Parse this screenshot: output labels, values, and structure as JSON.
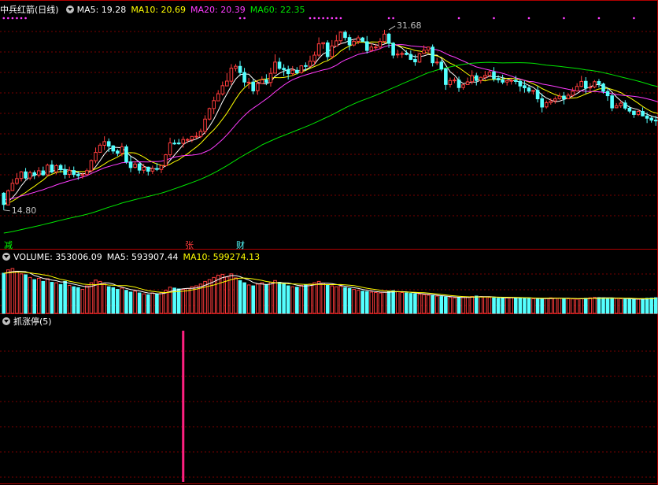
{
  "main_legend": {
    "stock_title": "中兵红箭(日线)",
    "ma5": "MA5: 19.28",
    "ma10": "MA10: 20.69",
    "ma20": "MA20: 20.39",
    "ma60": "MA60: 22.35"
  },
  "volume_legend": {
    "volume": "VOLUME: 353006.09",
    "ma5": "MA5: 593907.44",
    "ma10": "MA10: 599274.13"
  },
  "indicator_legend": {
    "name": "抓涨停(5)"
  },
  "event_tags": {
    "jian": "减",
    "zhang": "张",
    "cai": "财"
  },
  "colors": {
    "up": "#ff3c3c",
    "down": "#54ffff",
    "ma5": "#ffffff",
    "ma10": "#ffff00",
    "ma20": "#ff3cff",
    "ma60": "#00e600",
    "grid": "#7a0000",
    "bar_signal": "#ff2080",
    "magenta_dots": "#ff3cff"
  },
  "chart_data": [
    {
      "type": "candlestick",
      "title": "中兵红箭(日线)",
      "ylim": [
        12.5,
        33
      ],
      "annotations": [
        {
          "text": "31.68",
          "x": 88,
          "y": 31.68,
          "kind": "high"
        },
        {
          "text": "14.80",
          "x": 0,
          "y": 14.8,
          "kind": "low"
        }
      ],
      "ma_last": {
        "MA5": 19.28,
        "MA10": 20.69,
        "MA20": 20.39,
        "MA60": 22.35
      },
      "candles": [
        [
          16.38,
          15.32,
          16.48,
          14.8
        ],
        [
          15.28,
          16.61,
          16.73,
          15.28
        ],
        [
          16.63,
          17.31,
          17.72,
          16.59
        ],
        [
          17.3,
          17.75,
          18.27,
          17.16
        ],
        [
          17.76,
          18.38,
          18.46,
          17.48
        ],
        [
          18.38,
          17.8,
          18.74,
          17.66
        ],
        [
          17.8,
          18.31,
          18.49,
          17.59
        ],
        [
          18.3,
          18.05,
          18.51,
          17.7
        ],
        [
          18.08,
          18.48,
          18.82,
          17.86
        ],
        [
          18.47,
          18.1,
          18.87,
          17.99
        ],
        [
          18.1,
          19.01,
          19.15,
          17.92
        ],
        [
          19.03,
          18.37,
          19.47,
          18.23
        ],
        [
          18.38,
          18.96,
          19.1,
          18.15
        ],
        [
          18.97,
          18.58,
          19.14,
          18.3
        ],
        [
          18.59,
          18.14,
          19.07,
          17.75
        ],
        [
          18.14,
          18.52,
          18.87,
          17.81
        ],
        [
          18.5,
          18.13,
          18.88,
          17.86
        ],
        [
          18.14,
          18.02,
          18.42,
          17.64
        ],
        [
          18.04,
          18.13,
          18.29,
          17.74
        ],
        [
          18.13,
          18.49,
          18.7,
          18.1
        ],
        [
          18.48,
          19.44,
          19.55,
          18.31
        ],
        [
          19.42,
          20.2,
          20.66,
          19.18
        ],
        [
          20.21,
          20.88,
          21.07,
          20.17
        ],
        [
          20.87,
          21.21,
          21.71,
          20.42
        ],
        [
          21.21,
          20.79,
          21.51,
          20.24
        ],
        [
          20.81,
          20.33,
          20.89,
          20.06
        ],
        [
          20.33,
          20.12,
          20.51,
          19.85
        ],
        [
          20.13,
          20.73,
          21.08,
          19.83
        ],
        [
          20.72,
          19.31,
          20.93,
          19.12
        ],
        [
          19.31,
          18.78,
          19.84,
          18.35
        ],
        [
          18.8,
          19.11,
          19.36,
          18.7
        ],
        [
          19.12,
          18.54,
          19.27,
          18.21
        ],
        [
          18.53,
          18.81,
          19.13,
          18.23
        ],
        [
          18.82,
          18.44,
          18.87,
          18.04
        ],
        [
          18.45,
          18.69,
          18.96,
          18.17
        ],
        [
          18.69,
          18.61,
          19.2,
          18.45
        ],
        [
          18.6,
          18.97,
          19.01,
          18.26
        ],
        [
          18.96,
          19.98,
          20.05,
          18.85
        ],
        [
          19.98,
          21.09,
          21.58,
          19.79
        ],
        [
          21.07,
          21.06,
          21.39,
          20.92
        ],
        [
          21.08,
          21.04,
          21.46,
          20.92
        ],
        [
          21.05,
          21.41,
          21.69,
          20.64
        ],
        [
          21.4,
          21.41,
          21.54,
          21.08
        ],
        [
          21.4,
          21.69,
          21.74,
          21.15
        ],
        [
          21.68,
          21.71,
          22.1,
          21.51
        ],
        [
          21.7,
          22.18,
          22.42,
          21.54
        ],
        [
          22.17,
          23.32,
          23.68,
          21.91
        ],
        [
          23.32,
          24.31,
          24.4,
          23.19
        ],
        [
          24.31,
          25.05,
          25.42,
          23.8
        ],
        [
          25.03,
          25.69,
          26.03,
          25.05
        ],
        [
          25.68,
          26.45,
          26.84,
          25.52
        ],
        [
          26.43,
          26.88,
          27.64,
          26.42
        ],
        [
          26.87,
          28.09,
          28.47,
          26.51
        ],
        [
          28.07,
          28.27,
          28.48,
          27.79
        ],
        [
          28.26,
          27.68,
          28.77,
          27.36
        ],
        [
          27.69,
          26.79,
          28.11,
          26.37
        ],
        [
          26.78,
          26.78,
          27.18,
          26.16
        ],
        [
          26.79,
          25.96,
          27.04,
          25.65
        ],
        [
          25.98,
          26.65,
          26.96,
          25.59
        ],
        [
          26.65,
          27.0,
          27.33,
          26.66
        ],
        [
          27.0,
          26.76,
          27.52,
          26.5
        ],
        [
          26.75,
          27.6,
          28.13,
          26.36
        ],
        [
          27.62,
          28.66,
          29.39,
          27.59
        ],
        [
          28.66,
          28.07,
          29.06,
          27.93
        ],
        [
          28.08,
          27.94,
          28.46,
          27.34
        ],
        [
          27.94,
          27.58,
          28.32,
          27.03
        ],
        [
          27.58,
          27.9,
          28.29,
          27.35
        ],
        [
          27.89,
          27.66,
          28.19,
          27.5
        ],
        [
          27.67,
          28.31,
          28.37,
          27.57
        ],
        [
          28.33,
          28.28,
          28.63,
          27.83
        ],
        [
          28.27,
          28.74,
          29.26,
          28.19
        ],
        [
          28.72,
          29.31,
          29.64,
          28.37
        ],
        [
          29.31,
          30.37,
          30.97,
          29.15
        ],
        [
          30.37,
          30.48,
          30.51,
          29.91
        ],
        [
          30.46,
          29.17,
          30.7,
          28.84
        ],
        [
          29.17,
          30.17,
          30.72,
          28.93
        ],
        [
          30.16,
          30.65,
          31.21,
          30.13
        ],
        [
          30.66,
          31.46,
          31.55,
          30.31
        ],
        [
          31.45,
          30.96,
          31.63,
          30.68
        ],
        [
          30.96,
          30.27,
          31.25,
          29.76
        ],
        [
          30.26,
          30.61,
          30.79,
          30.12
        ],
        [
          30.6,
          30.93,
          31.15,
          30.34
        ],
        [
          30.92,
          30.59,
          31.02,
          30.53
        ],
        [
          30.57,
          29.75,
          31.1,
          29.46
        ],
        [
          29.75,
          30.07,
          30.43,
          29.64
        ],
        [
          30.07,
          30.07,
          30.38,
          29.8
        ],
        [
          30.07,
          30.6,
          30.91,
          29.85
        ],
        [
          30.59,
          31.28,
          31.68,
          30.41
        ],
        [
          31.28,
          30.42,
          31.4,
          29.99
        ],
        [
          30.43,
          29.31,
          30.53,
          29.0
        ],
        [
          29.33,
          29.41,
          29.82,
          29.04
        ],
        [
          29.42,
          29.46,
          29.65,
          29.05
        ],
        [
          29.48,
          29.37,
          29.77,
          29.29
        ],
        [
          29.37,
          28.91,
          29.75,
          28.85
        ],
        [
          28.91,
          28.68,
          29.35,
          28.31
        ],
        [
          28.66,
          29.45,
          29.55,
          28.59
        ],
        [
          29.47,
          29.77,
          30.23,
          29.4
        ],
        [
          29.78,
          30.07,
          30.1,
          29.46
        ],
        [
          30.06,
          28.6,
          30.31,
          28.25
        ],
        [
          28.59,
          28.66,
          29.06,
          28.37
        ],
        [
          28.66,
          28.0,
          28.88,
          27.81
        ],
        [
          28.02,
          26.56,
          28.13,
          26.06
        ],
        [
          26.55,
          26.93,
          27.21,
          26.28
        ],
        [
          26.93,
          26.98,
          27.22,
          26.69
        ],
        [
          26.97,
          26.27,
          27.3,
          25.87
        ],
        [
          26.28,
          26.53,
          26.62,
          26.07
        ],
        [
          26.55,
          26.81,
          27.21,
          26.53
        ],
        [
          26.82,
          27.38,
          27.89,
          26.57
        ],
        [
          27.38,
          26.94,
          27.65,
          26.47
        ],
        [
          26.93,
          27.23,
          27.3,
          26.65
        ],
        [
          27.23,
          27.41,
          27.83,
          26.96
        ],
        [
          27.42,
          27.72,
          27.88,
          27.26
        ],
        [
          27.73,
          27.1,
          28.19,
          26.84
        ],
        [
          27.13,
          27.0,
          27.42,
          26.71
        ],
        [
          26.99,
          26.78,
          27.48,
          26.58
        ],
        [
          26.79,
          26.92,
          26.96,
          26.46
        ],
        [
          26.92,
          26.94,
          27.15,
          26.55
        ],
        [
          26.95,
          26.85,
          27.38,
          26.57
        ],
        [
          26.86,
          26.42,
          27.0,
          25.89
        ],
        [
          26.45,
          26.25,
          26.91,
          25.8
        ],
        [
          26.24,
          25.94,
          26.43,
          25.75
        ],
        [
          25.95,
          26.0,
          26.03,
          25.62
        ],
        [
          26.01,
          25.22,
          26.41,
          24.88
        ],
        [
          25.23,
          24.45,
          25.72,
          23.95
        ],
        [
          24.46,
          24.85,
          25.06,
          24.31
        ],
        [
          24.86,
          25.01,
          25.26,
          24.67
        ],
        [
          25.03,
          25.21,
          25.44,
          24.76
        ],
        [
          25.23,
          25.47,
          25.72,
          25.14
        ],
        [
          25.48,
          25.22,
          25.86,
          24.7
        ],
        [
          25.22,
          25.56,
          25.74,
          25.19
        ],
        [
          25.55,
          25.93,
          26.28,
          25.38
        ],
        [
          25.96,
          26.38,
          26.68,
          25.89
        ],
        [
          26.38,
          26.85,
          27.37,
          26.3
        ],
        [
          26.86,
          26.23,
          27.25,
          25.72
        ],
        [
          26.24,
          26.31,
          26.69,
          25.91
        ],
        [
          26.33,
          26.82,
          26.98,
          26.2
        ],
        [
          26.84,
          26.62,
          27.08,
          26.27
        ],
        [
          26.61,
          25.93,
          26.73,
          25.71
        ],
        [
          25.91,
          25.51,
          26.25,
          25.03
        ],
        [
          25.5,
          24.37,
          25.7,
          24.06
        ],
        [
          24.38,
          24.57,
          24.82,
          24.34
        ],
        [
          24.58,
          24.81,
          25.05,
          24.37
        ],
        [
          24.83,
          24.35,
          25.09,
          24.17
        ],
        [
          24.34,
          24.07,
          24.56,
          23.88
        ],
        [
          24.07,
          23.75,
          24.1,
          23.43
        ],
        [
          23.74,
          24.04,
          24.23,
          23.6
        ],
        [
          24.04,
          23.62,
          24.42,
          23.58
        ],
        [
          23.61,
          23.4,
          23.95,
          22.95
        ],
        [
          23.41,
          23.22,
          23.55,
          22.99
        ],
        [
          23.22,
          23.17,
          23.62,
          22.69
        ],
        [
          23.16,
          23.44,
          23.73,
          23.03
        ],
        [
          23.46,
          23.29,
          23.64,
          22.97
        ],
        [
          23.27,
          22.66,
          23.49,
          22.52
        ],
        [
          22.67,
          22.06,
          23.17,
          21.57
        ],
        [
          22.05,
          21.91,
          22.29,
          21.53
        ]
      ],
      "event_markers": [
        {
          "label_key": "jian",
          "x": 0,
          "color": "#00ff00"
        },
        {
          "label_key": "zhang",
          "x": 41,
          "color": "#ff3c3c"
        },
        {
          "label_key": "cai",
          "x": 54,
          "color": "#54ffff"
        }
      ],
      "magenta_dot_columns": [
        0,
        1,
        2,
        3,
        4,
        5,
        54,
        55,
        70,
        71,
        72,
        73,
        74,
        75,
        76,
        77,
        88,
        89,
        104,
        112,
        120,
        128,
        136,
        144
      ]
    },
    {
      "type": "bar",
      "title": "VOLUME",
      "values": [
        905000,
        980000,
        1010000,
        950000,
        890000,
        870000,
        810000,
        760000,
        790000,
        720000,
        780000,
        700000,
        690000,
        650000,
        720000,
        630000,
        600000,
        580000,
        540000,
        620000,
        690000,
        750000,
        720000,
        660000,
        600000,
        580000,
        540000,
        570000,
        520000,
        480000,
        500000,
        460000,
        440000,
        420000,
        460000,
        430000,
        470000,
        520000,
        590000,
        570000,
        550000,
        540000,
        560000,
        600000,
        620000,
        660000,
        720000,
        760000,
        810000,
        860000,
        880000,
        820000,
        890000,
        800000,
        740000,
        690000,
        640000,
        620000,
        660000,
        690000,
        640000,
        700000,
        740000,
        700000,
        660000,
        620000,
        600000,
        590000,
        630000,
        640000,
        660000,
        690000,
        720000,
        680000,
        640000,
        620000,
        600000,
        610000,
        580000,
        560000,
        540000,
        520000,
        500000,
        490000,
        480000,
        470000,
        460000,
        480000,
        500000,
        510000,
        490000,
        470000,
        460000,
        450000,
        440000,
        430000,
        420000,
        410000,
        400000,
        390000,
        380000,
        370000,
        360000,
        350000,
        355000,
        360000,
        370000,
        380000,
        390000,
        380000,
        370000,
        360000,
        350000,
        340000,
        345000,
        350000,
        360000,
        355000,
        350000,
        345000,
        340000,
        330000,
        320000,
        330000,
        340000,
        350000,
        345000,
        340000,
        335000,
        330000,
        325000,
        320000,
        330000,
        340000,
        350000,
        360000,
        355000,
        350000,
        345000,
        340000,
        335000,
        330000,
        325000,
        320000,
        315000,
        320000,
        330000,
        340000,
        345000,
        353006
      ],
      "ma_last": {
        "MA5": 593907.44,
        "MA10": 599274.13
      }
    },
    {
      "type": "bar",
      "title": "抓涨停(5)",
      "signals": [
        {
          "x": 41,
          "value": 1
        }
      ]
    }
  ]
}
